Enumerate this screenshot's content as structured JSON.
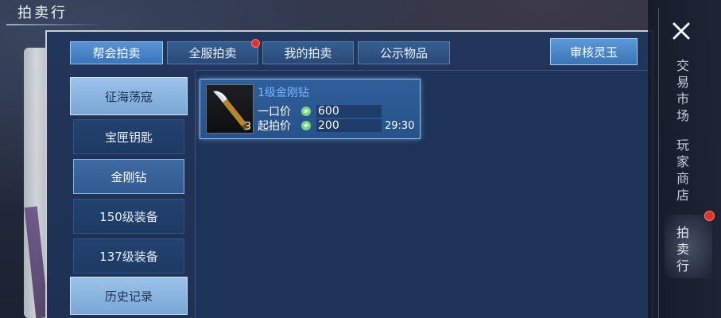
{
  "window_title": "拍卖行",
  "tabs": [
    {
      "label": "帮会拍卖",
      "active": true
    },
    {
      "label": "全服拍卖",
      "active": false,
      "badge": true
    },
    {
      "label": "我的拍卖",
      "active": false
    },
    {
      "label": "公示物品",
      "active": false
    }
  ],
  "review_button": "审核灵玉",
  "categories": [
    {
      "label": "征海荡寇",
      "style": "big"
    },
    {
      "label": "宝匣钥匙",
      "style": "normal"
    },
    {
      "label": "金刚钻",
      "style": "selected"
    },
    {
      "label": "150级装备",
      "style": "normal"
    },
    {
      "label": "137级装备",
      "style": "normal"
    },
    {
      "label": "历史记录",
      "style": "big"
    }
  ],
  "item": {
    "name": "1级金刚钻",
    "quantity": "3",
    "buyout_label": "一口价",
    "buyout_price": "600",
    "start_label": "起拍价",
    "start_price": "200",
    "time_left": "29:30",
    "icon": "diamond-drill-icon",
    "coin_icon": "jade-coin-icon"
  },
  "right_nav": {
    "close_icon": "close-icon",
    "items": [
      {
        "label": "交易市场"
      },
      {
        "label": "玩家商店"
      },
      {
        "label": "拍卖行",
        "active": true,
        "badge": true
      }
    ]
  },
  "colors": {
    "active_tab": "#5a93d4",
    "item_name": "#79b6ff",
    "badge": "#e0322a"
  }
}
